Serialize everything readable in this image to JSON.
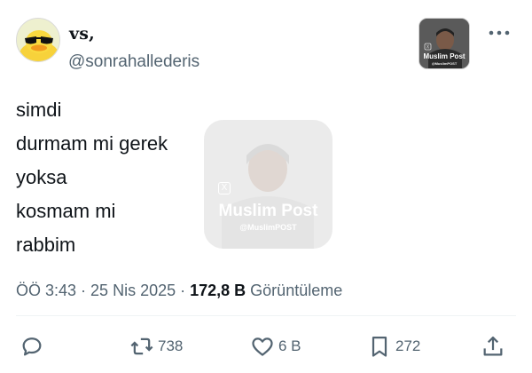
{
  "author": {
    "display_name": "vs,",
    "handle": "@sonrahallederis"
  },
  "badge": {
    "title": "Muslim Post",
    "subtitle": "@MuslimPOST"
  },
  "tweet": {
    "lines": [
      "simdi",
      "durmam mi gerek",
      "yoksa",
      "kosmam mi",
      "rabbim"
    ]
  },
  "watermark": {
    "title": "Muslim Post",
    "subtitle": "@MuslimPOST"
  },
  "meta": {
    "time": "ÖÖ 3:43",
    "sep1": " · ",
    "date": "25 Nis 2025",
    "sep2": " · ",
    "views_count": "172,8 B",
    "views_label": " Görüntüleme"
  },
  "actions": {
    "retweets": "738",
    "likes": "6 B",
    "bookmarks": "272"
  },
  "icons": {
    "reply": "reply-icon",
    "retweet": "retweet-icon",
    "like": "heart-icon",
    "bookmark": "bookmark-icon",
    "share": "share-icon",
    "more": "more-dots-icon"
  }
}
